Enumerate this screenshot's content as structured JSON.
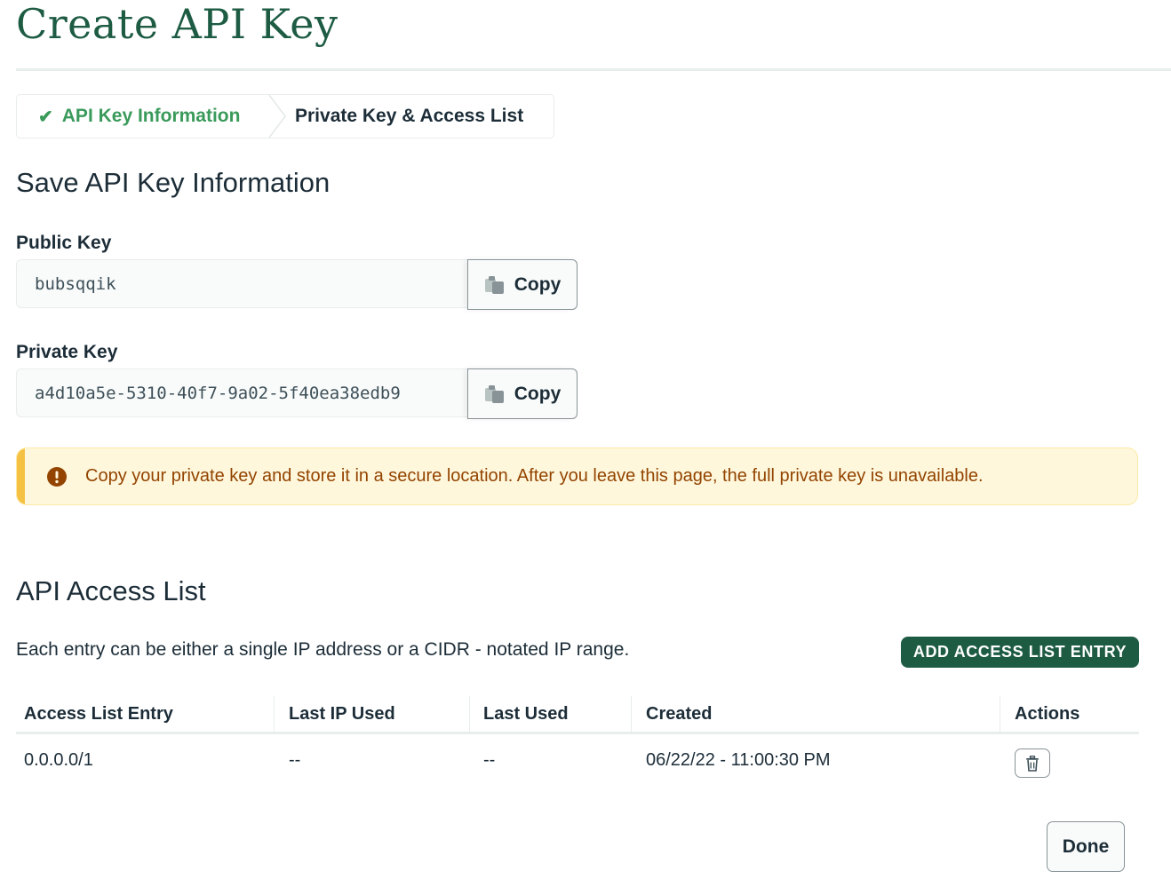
{
  "page": {
    "title": "Create API Key"
  },
  "stepper": {
    "steps": [
      {
        "label": "API Key Information",
        "status": "complete"
      },
      {
        "label": "Private Key & Access List",
        "status": "current"
      }
    ]
  },
  "save_section": {
    "title": "Save API Key Information",
    "public_key": {
      "label": "Public Key",
      "value": "bubsqqik",
      "copy_label": "Copy"
    },
    "private_key": {
      "label": "Private Key",
      "value": "a4d10a5e-5310-40f7-9a02-5f40ea38edb9",
      "copy_label": "Copy"
    },
    "warning": "Copy your private key and store it in a secure location. After you leave this page, the full private key is unavailable."
  },
  "access_list": {
    "title": "API Access List",
    "description": "Each entry can be either a single IP address or a CIDR - notated IP range.",
    "add_button": "ADD ACCESS LIST ENTRY",
    "columns": [
      "Access List Entry",
      "Last IP Used",
      "Last Used",
      "Created",
      "Actions"
    ],
    "rows": [
      {
        "entry": "0.0.0.0/1",
        "last_ip": "--",
        "last_used": "--",
        "created": "06/22/22 - 11:00:30 PM"
      }
    ]
  },
  "footer": {
    "done_label": "Done"
  },
  "colors": {
    "brand_green": "#1d5b43",
    "step_green": "#3a9a5a",
    "warning_bg": "#fef7dc",
    "warning_text": "#934400",
    "warning_bar": "#f5c143"
  },
  "icons": [
    "check-icon",
    "chevron-separator-icon",
    "copy-icon",
    "warning-icon",
    "trash-icon"
  ]
}
